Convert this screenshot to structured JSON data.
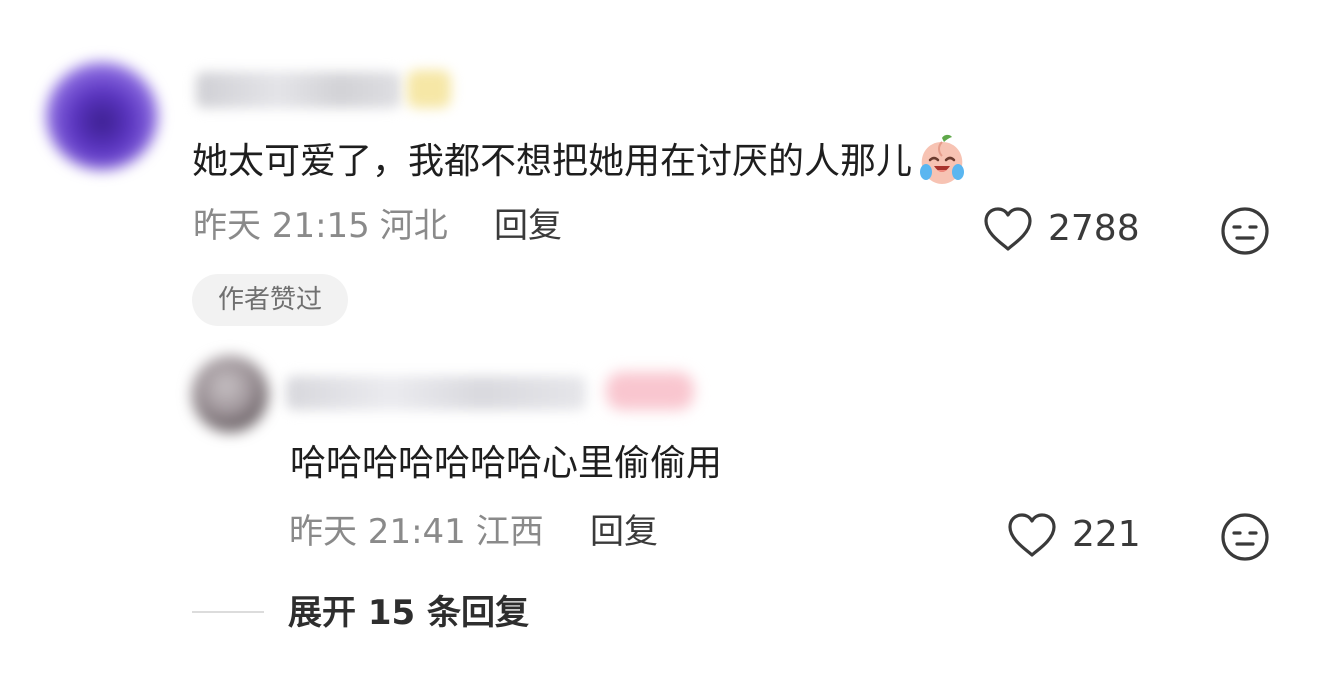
{
  "comment": {
    "text": "她太可爱了，我都不想把她用在讨厌的人那儿",
    "emoji_icon": "crying-laughing-peach-emoji",
    "time": "昨天 21:15",
    "location": "河北",
    "reply_label": "回复",
    "like_count": "2788",
    "author_liked_badge": "作者赞过"
  },
  "reply": {
    "text": "哈哈哈哈哈哈哈心里偷偷用",
    "time": "昨天 21:41",
    "location": "江西",
    "reply_label": "回复",
    "like_count": "221"
  },
  "expand_label": "展开 15 条回复",
  "colors": {
    "text_primary": "#1e1e1e",
    "text_secondary": "#8a8a8a",
    "badge_bg": "#f2f2f2",
    "icon_stroke": "#3a3a3a"
  }
}
